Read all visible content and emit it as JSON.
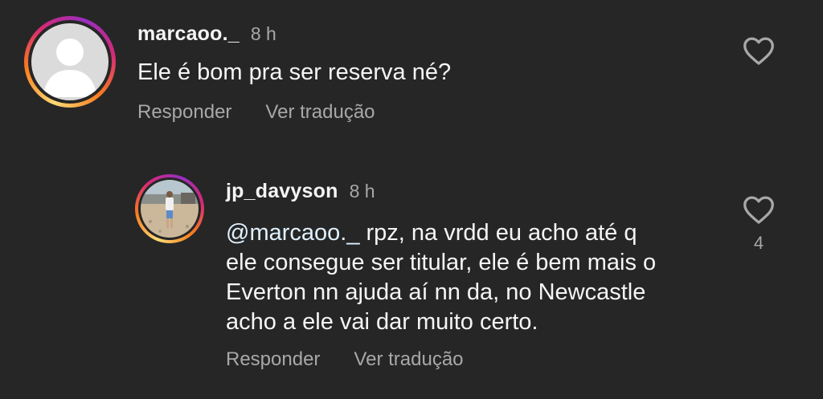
{
  "comments": [
    {
      "username": "marcaoo._",
      "time": "8 h",
      "text_lines": [
        "Ele é bom pra ser reserva né?"
      ],
      "actions": {
        "reply": "Responder",
        "translate": "Ver tradução"
      },
      "avatar": "default-avatar-icon",
      "like_icon": "heart-outline-icon"
    },
    {
      "username": "jp_davyson",
      "time": "8 h",
      "mention": "@marcaoo._",
      "text_lines": [
        " rpz, na vrdd eu acho até q",
        "ele consegue ser titular, ele é bem mais o",
        "Everton nn ajuda aí nn da, no Newcastle",
        "acho a ele vai dar muito certo."
      ],
      "actions": {
        "reply": "Responder",
        "translate": "Ver tradução"
      },
      "avatar": "beach-photo-avatar",
      "like_icon": "heart-outline-icon",
      "like_count": "4"
    }
  ],
  "colors": {
    "background": "#262626",
    "primary_text": "#f5f5f5",
    "secondary_text": "#a8a8a8",
    "story_ring": [
      "#feda75",
      "#fa7e1e",
      "#d62976",
      "#962fbf"
    ]
  }
}
